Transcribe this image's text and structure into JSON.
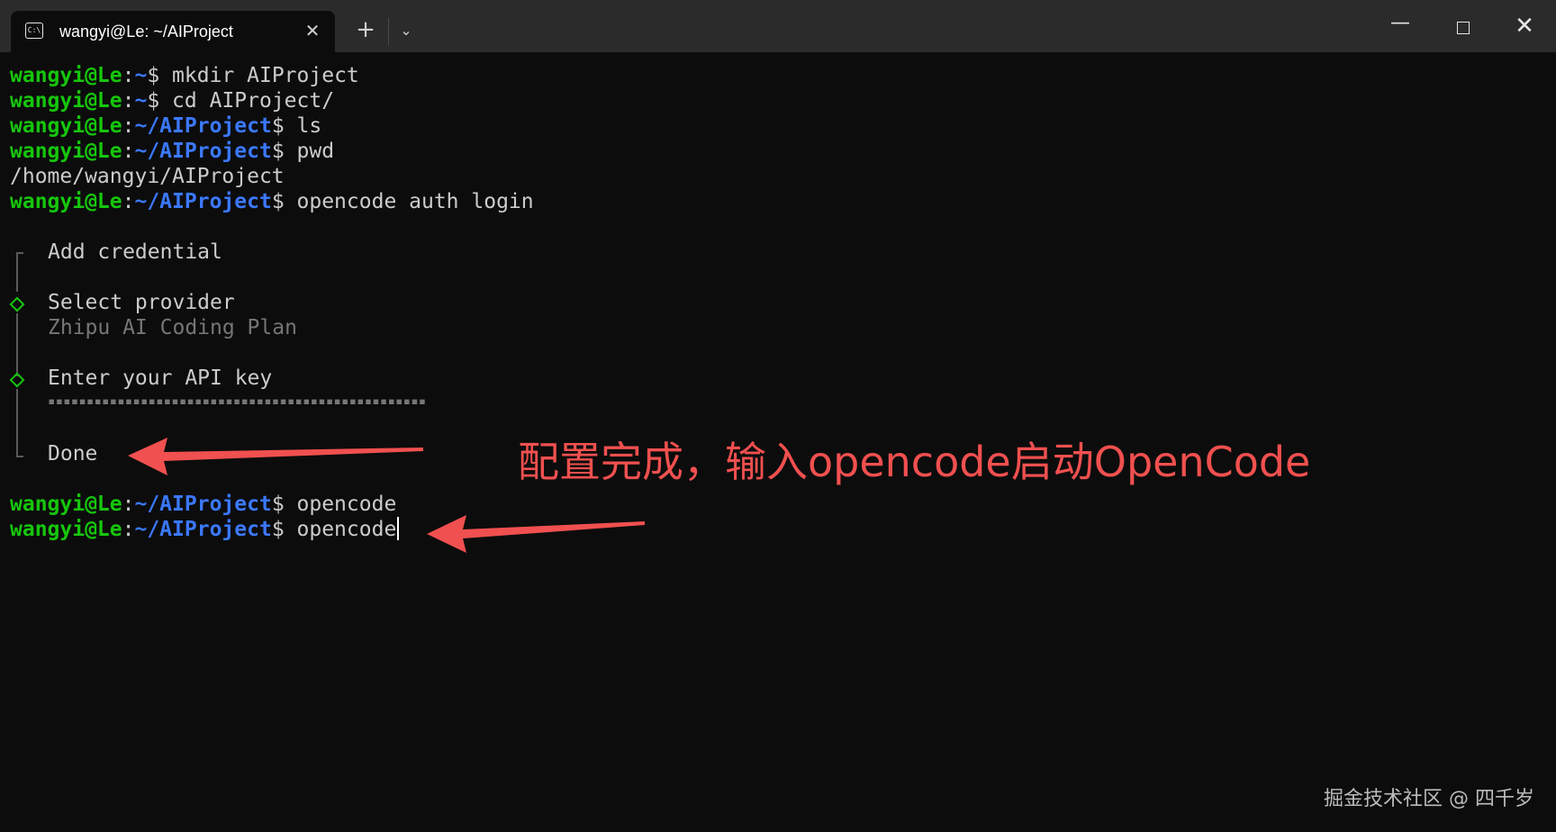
{
  "window": {
    "tab_title": "wangyi@Le: ~/AIProject",
    "tab_icon_text": "C:\\",
    "tab_close": "✕",
    "new_tab": "+",
    "dropdown": "⌄",
    "minimize": "—",
    "close": "✕"
  },
  "prompt": {
    "user": "wangyi@Le",
    "sep": ":",
    "home": "~",
    "project_path": "~/AIProject",
    "dollar": "$"
  },
  "terminal": {
    "cmd_mkdir": " mkdir AIProject",
    "cmd_cd": " cd AIProject/",
    "cmd_ls": " ls",
    "cmd_pwd": " pwd",
    "pwd_output": "/home/wangyi/AIProject",
    "cmd_auth": " opencode auth login",
    "cmd_opencode_1": " opencode",
    "cmd_opencode_2": " opencode"
  },
  "wizard": {
    "title": "Add credential",
    "select_provider_label": "Select provider",
    "selected_provider": "Zhipu AI Coding Plan",
    "api_key_label": "Enter your API key",
    "api_key_masked": "▪▪▪▪▪▪▪▪▪▪▪▪▪▪▪▪▪▪▪▪▪▪▪▪▪▪▪▪▪▪▪▪▪▪▪▪▪▪▪▪▪▪▪▪▪▪▪▪▪",
    "done": "Done"
  },
  "annotation": {
    "text": "配置完成，输入opencode启动OpenCode",
    "color": "#f0504f"
  },
  "watermark": "掘金技术社区 @ 四千岁",
  "colors": {
    "background": "#0c0c0c",
    "titlebar": "#2b2b2b",
    "prompt_user": "#16c60c",
    "prompt_path": "#3b78ff",
    "text": "#cccccc",
    "dim_text": "#767676"
  }
}
